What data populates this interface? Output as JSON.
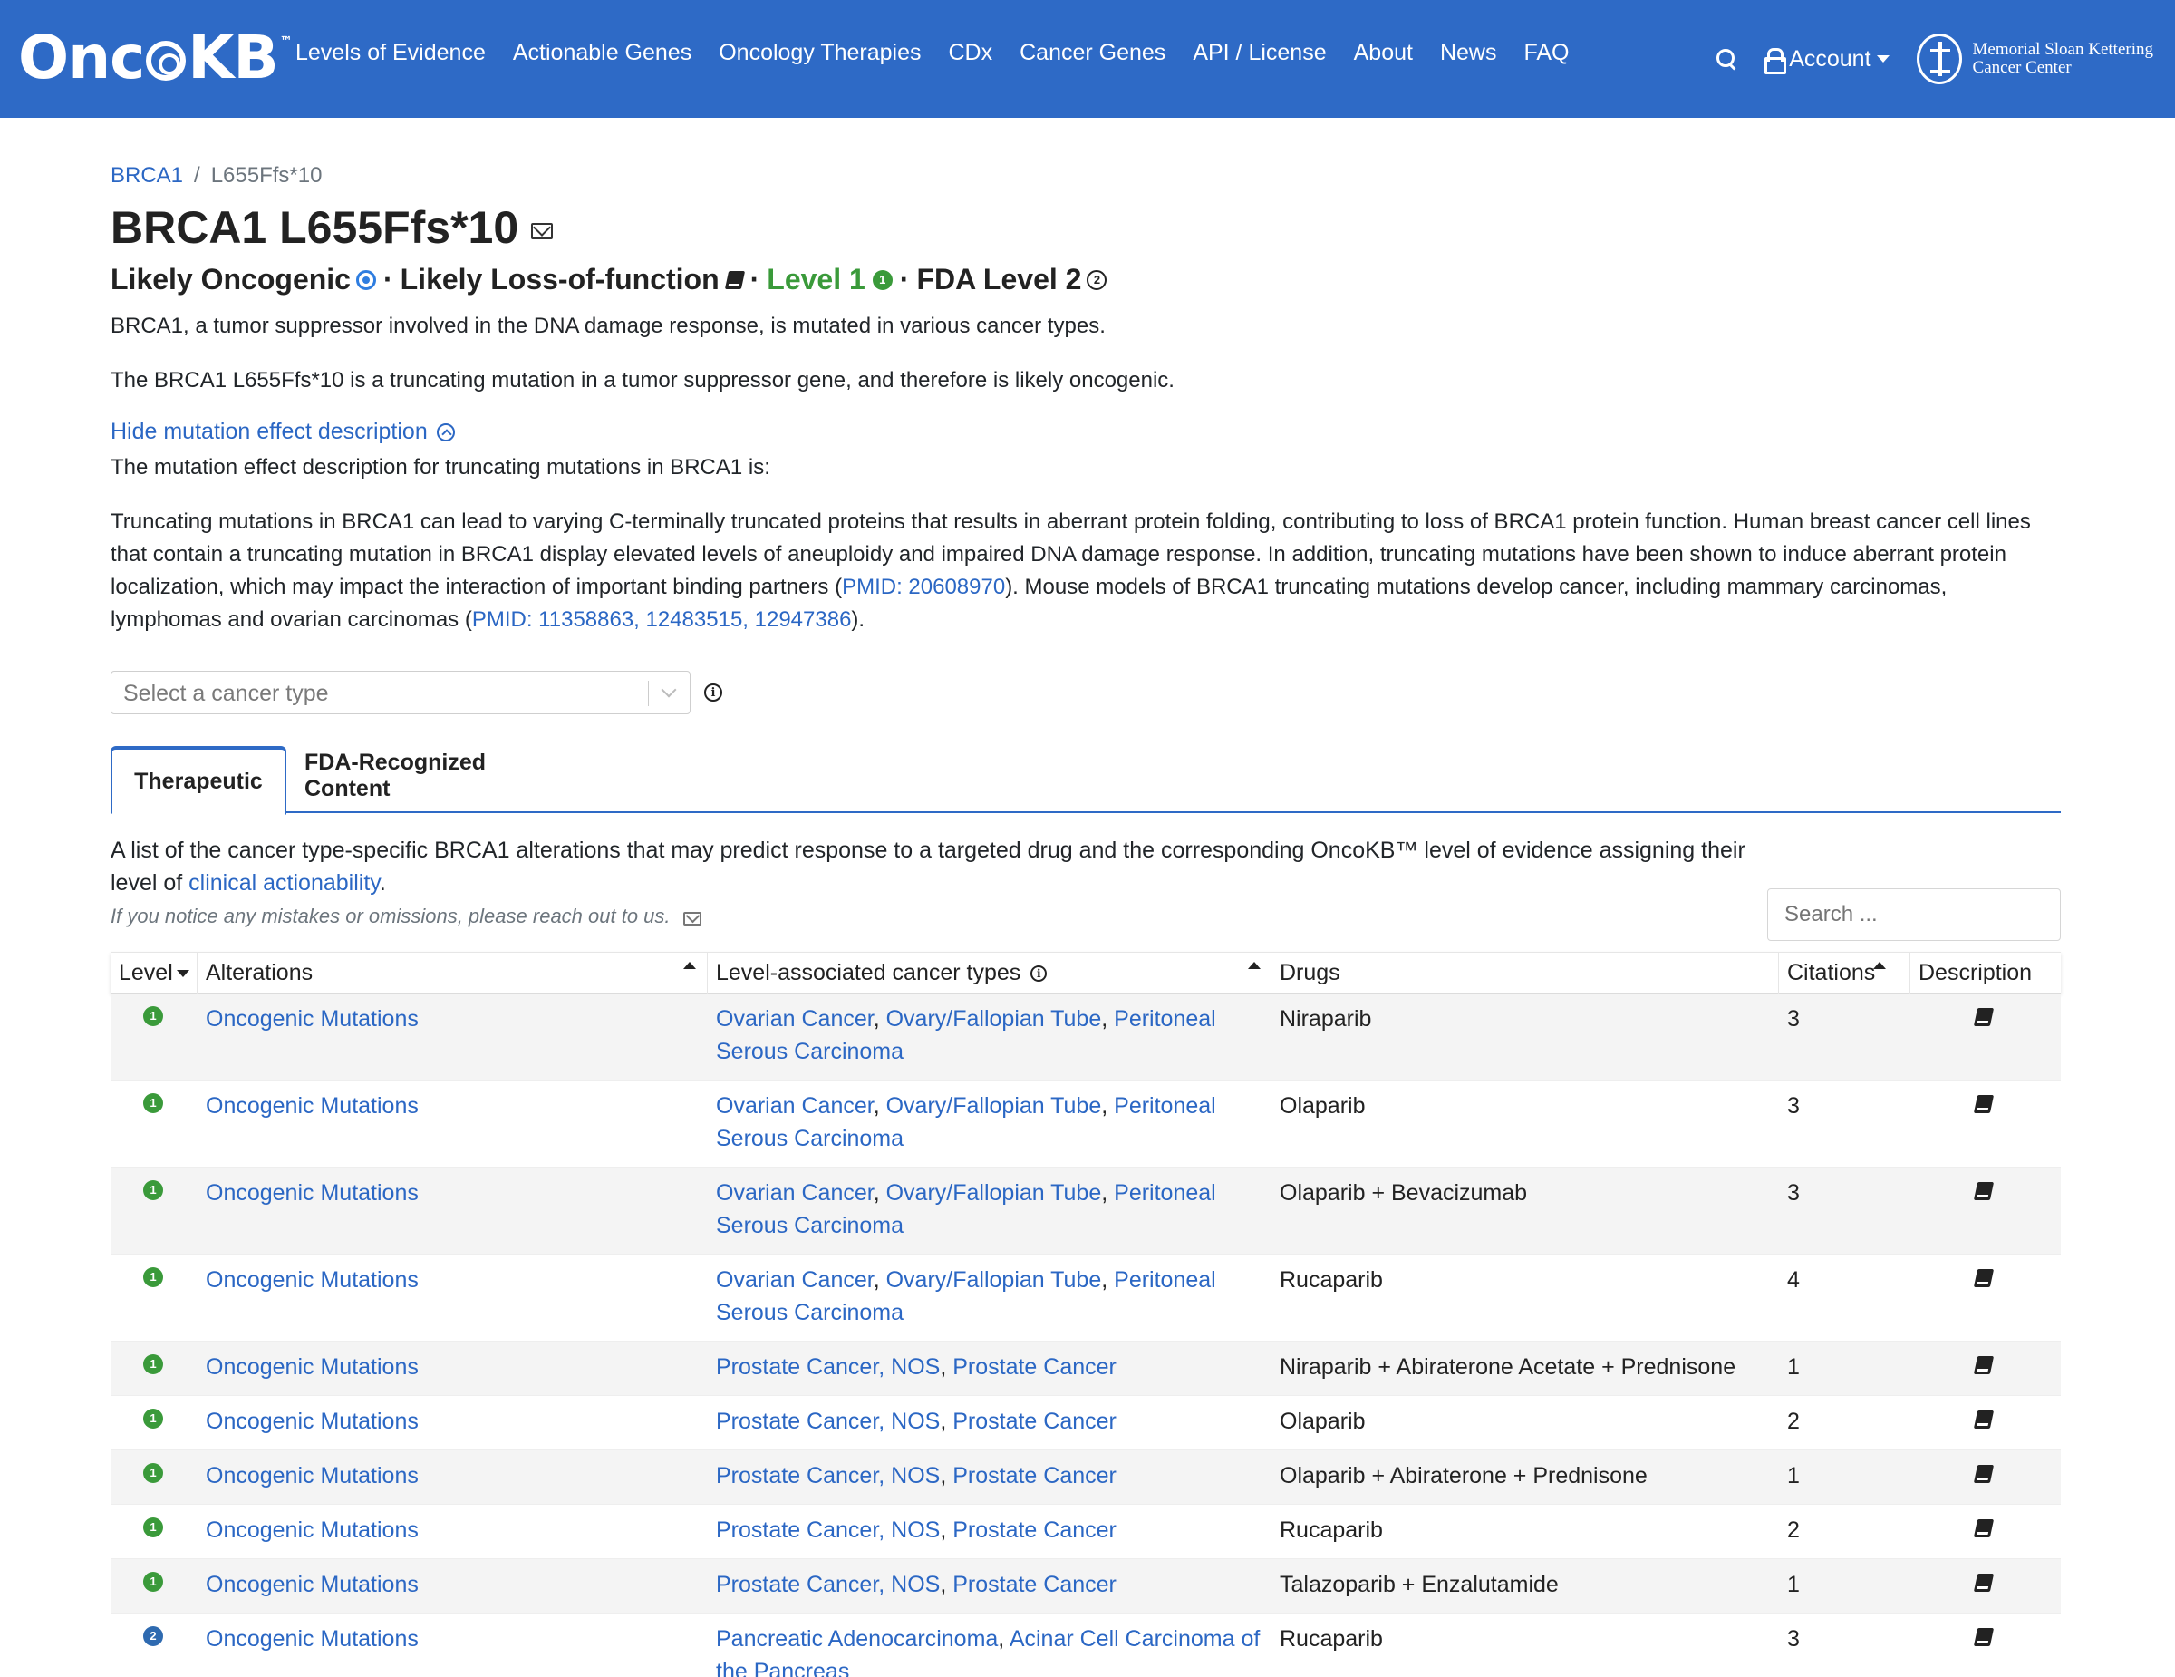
{
  "nav": {
    "logo_text": "Onc",
    "logo_text2": "KB",
    "logo_tm": "™",
    "links": [
      "Levels of Evidence",
      "Actionable Genes",
      "Oncology Therapies",
      "CDx",
      "Cancer Genes",
      "API / License",
      "About",
      "News",
      "FAQ"
    ],
    "account": "Account",
    "mskcc_line1": "Memorial Sloan Kettering",
    "mskcc_line2": "Cancer Center"
  },
  "breadcrumb": {
    "gene": "BRCA1",
    "sep": "/",
    "alteration": "L655Ffs*10"
  },
  "title": "BRCA1 L655Ffs*10",
  "summary": {
    "oncogenicity": "Likely Oncogenic",
    "effect": "Likely Loss-of-function",
    "level": "Level 1",
    "level_badge": "1",
    "fda_level": "FDA Level 2",
    "fda_badge": "2",
    "dot": "·"
  },
  "gene_summary": "BRCA1, a tumor suppressor involved in the DNA damage response, is mutated in various cancer types.",
  "variant_summary": "The BRCA1 L655Ffs*10 is a truncating mutation in a tumor suppressor gene, and therefore is likely oncogenic.",
  "toggle_label": "Hide mutation effect description",
  "effect_intro": "The mutation effect description for truncating mutations in BRCA1 is:",
  "effect_desc": {
    "part1": "Truncating mutations in BRCA1 can lead to varying C-terminally truncated proteins that results in aberrant protein folding, contributing to loss of BRCA1 protein function. Human breast cancer cell lines that contain a truncating mutation in BRCA1 display elevated levels of aneuploidy and impaired DNA damage response. In addition, truncating mutations have been shown to induce aberrant protein localization, which may impact the interaction of important binding partners (",
    "pmid1": "PMID: 20608970",
    "part2": "). Mouse models of BRCA1 truncating mutations develop cancer, including mammary carcinomas, lymphomas and ovarian carcinomas (",
    "pmid2": "PMID: 11358863, 12483515, 12947386",
    "part3": ")."
  },
  "select_placeholder": "Select a cancer type",
  "tabs": {
    "therapeutic": "Therapeutic",
    "fda": "FDA-Recognized Content"
  },
  "list_desc": {
    "part1": "A list of the cancer type-specific BRCA1 alterations that may predict response to a targeted drug and the corresponding OncoKB™ level of evidence assigning their level of ",
    "link": "clinical actionability",
    "part2": "."
  },
  "mistakes_note": "If you notice any mistakes or omissions, please reach out to us.",
  "search_placeholder": "Search ...",
  "table": {
    "headers": {
      "level": "Level",
      "alterations": "Alterations",
      "cancer_types": "Level-associated cancer types",
      "drugs": "Drugs",
      "citations": "Citations",
      "description": "Description"
    },
    "rows": [
      {
        "level": "1",
        "alteration": "Oncogenic Mutations",
        "cancer_types": [
          "Ovarian Cancer",
          "Ovary/Fallopian Tube",
          "Peritoneal Serous Carcinoma"
        ],
        "drugs": "Niraparib",
        "citations": "3"
      },
      {
        "level": "1",
        "alteration": "Oncogenic Mutations",
        "cancer_types": [
          "Ovarian Cancer",
          "Ovary/Fallopian Tube",
          "Peritoneal Serous Carcinoma"
        ],
        "drugs": "Olaparib",
        "citations": "3"
      },
      {
        "level": "1",
        "alteration": "Oncogenic Mutations",
        "cancer_types": [
          "Ovarian Cancer",
          "Ovary/Fallopian Tube",
          "Peritoneal Serous Carcinoma"
        ],
        "drugs": "Olaparib + Bevacizumab",
        "citations": "3"
      },
      {
        "level": "1",
        "alteration": "Oncogenic Mutations",
        "cancer_types": [
          "Ovarian Cancer",
          "Ovary/Fallopian Tube",
          "Peritoneal Serous Carcinoma"
        ],
        "drugs": "Rucaparib",
        "citations": "4"
      },
      {
        "level": "1",
        "alteration": "Oncogenic Mutations",
        "cancer_types": [
          "Prostate Cancer, NOS",
          "Prostate Cancer"
        ],
        "drugs": "Niraparib + Abiraterone Acetate + Prednisone",
        "citations": "1"
      },
      {
        "level": "1",
        "alteration": "Oncogenic Mutations",
        "cancer_types": [
          "Prostate Cancer, NOS",
          "Prostate Cancer"
        ],
        "drugs": "Olaparib",
        "citations": "2"
      },
      {
        "level": "1",
        "alteration": "Oncogenic Mutations",
        "cancer_types": [
          "Prostate Cancer, NOS",
          "Prostate Cancer"
        ],
        "drugs": "Olaparib + Abiraterone + Prednisone",
        "citations": "1"
      },
      {
        "level": "1",
        "alteration": "Oncogenic Mutations",
        "cancer_types": [
          "Prostate Cancer, NOS",
          "Prostate Cancer"
        ],
        "drugs": "Rucaparib",
        "citations": "2"
      },
      {
        "level": "1",
        "alteration": "Oncogenic Mutations",
        "cancer_types": [
          "Prostate Cancer, NOS",
          "Prostate Cancer"
        ],
        "drugs": "Talazoparib + Enzalutamide",
        "citations": "1"
      },
      {
        "level": "2",
        "alteration": "Oncogenic Mutations",
        "cancer_types": [
          "Pancreatic Adenocarcinoma",
          "Acinar Cell Carcinoma of the Pancreas"
        ],
        "drugs": "Rucaparib",
        "citations": "3"
      }
    ]
  },
  "colors": {
    "brand": "#2e6ac6",
    "link": "#2b67c4",
    "level1": "#3a9a3a",
    "level2": "#2e6ab0"
  }
}
